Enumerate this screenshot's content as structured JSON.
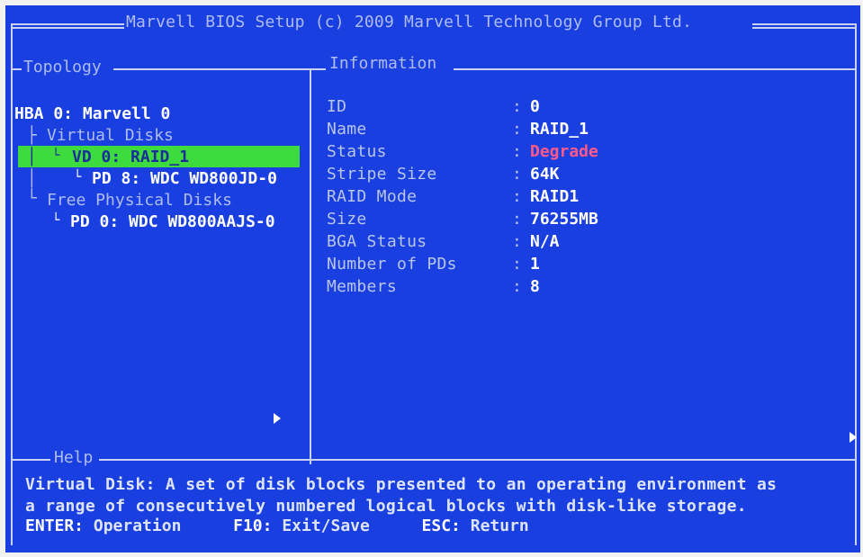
{
  "title": "Marvell BIOS Setup (c) 2009 Marvell Technology Group Ltd.",
  "topology": {
    "header": "Topology",
    "hba": "HBA 0: Marvell 0",
    "virtual_disks_label": "Virtual Disks",
    "selected_vd": "VD 0: RAID_1",
    "vd_member": "PD 8: WDC WD800JD-0",
    "free_disks_label": "Free Physical Disks",
    "free_disk": "PD 0: WDC WD800AAJS-0"
  },
  "information": {
    "header": "Information",
    "fields": [
      {
        "label": "ID",
        "value": "0"
      },
      {
        "label": "Name",
        "value": "RAID_1"
      },
      {
        "label": "Status",
        "value": "Degrade"
      },
      {
        "label": "Stripe Size",
        "value": "64K"
      },
      {
        "label": "RAID Mode",
        "value": "RAID1"
      },
      {
        "label": "Size",
        "value": "76255MB"
      },
      {
        "label": "BGA Status",
        "value": "N/A"
      },
      {
        "label": "Number of PDs",
        "value": "1"
      },
      {
        "label": "Members",
        "value": "8"
      }
    ],
    "colon": ":"
  },
  "help": {
    "header": "Help",
    "line1": "Virtual Disk: A set of disk blocks presented to an operating environment as",
    "line2": "a range of consecutively numbered logical blocks with disk-like storage.",
    "keys": [
      {
        "key": "ENTER:",
        "action": "Operation"
      },
      {
        "key": "F10:",
        "action": "Exit/Save"
      },
      {
        "key": "ESC:",
        "action": "Return"
      }
    ]
  },
  "colors": {
    "background": "#1a3fe0",
    "selection": "#3ddb3d",
    "status_degrade": "#ff5a8a"
  }
}
